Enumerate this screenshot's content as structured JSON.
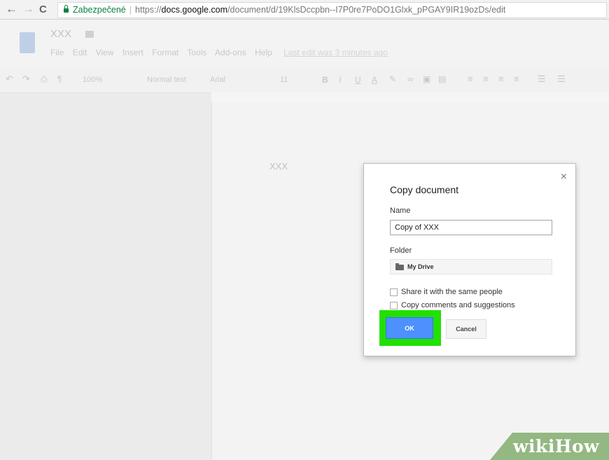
{
  "browser": {
    "back_icon": "←",
    "forward_icon": "→",
    "reload_icon": "C",
    "secure_label": "Zabezpečené",
    "url_prefix": "https://",
    "url_domain": "docs.google.com",
    "url_path": "/document/d/19KlsDccpbn--I7P0re7PoDO1Glxk_pPGAY9IR19ozDs/edit"
  },
  "doc": {
    "title": "XXX",
    "menus": [
      "File",
      "Edit",
      "View",
      "Insert",
      "Format",
      "Tools",
      "Add-ons",
      "Help"
    ],
    "last_edit": "Last edit was 3 minutes ago",
    "toolbar": {
      "zoom": "100%",
      "style": "Normal text",
      "font": "Arial",
      "size": "11"
    },
    "body_text": "XXX"
  },
  "dialog": {
    "title": "Copy document",
    "close_icon": "×",
    "name_label": "Name",
    "name_value": "Copy of XXX",
    "folder_label": "Folder",
    "folder_value": "My Drive",
    "share_label": "Share it with the same people",
    "share_checked": false,
    "comments_label": "Copy comments and suggestions",
    "comments_checked": false,
    "ok_label": "OK",
    "cancel_label": "Cancel"
  },
  "highlight_color": "#22e000",
  "watermark": "wikiHow"
}
